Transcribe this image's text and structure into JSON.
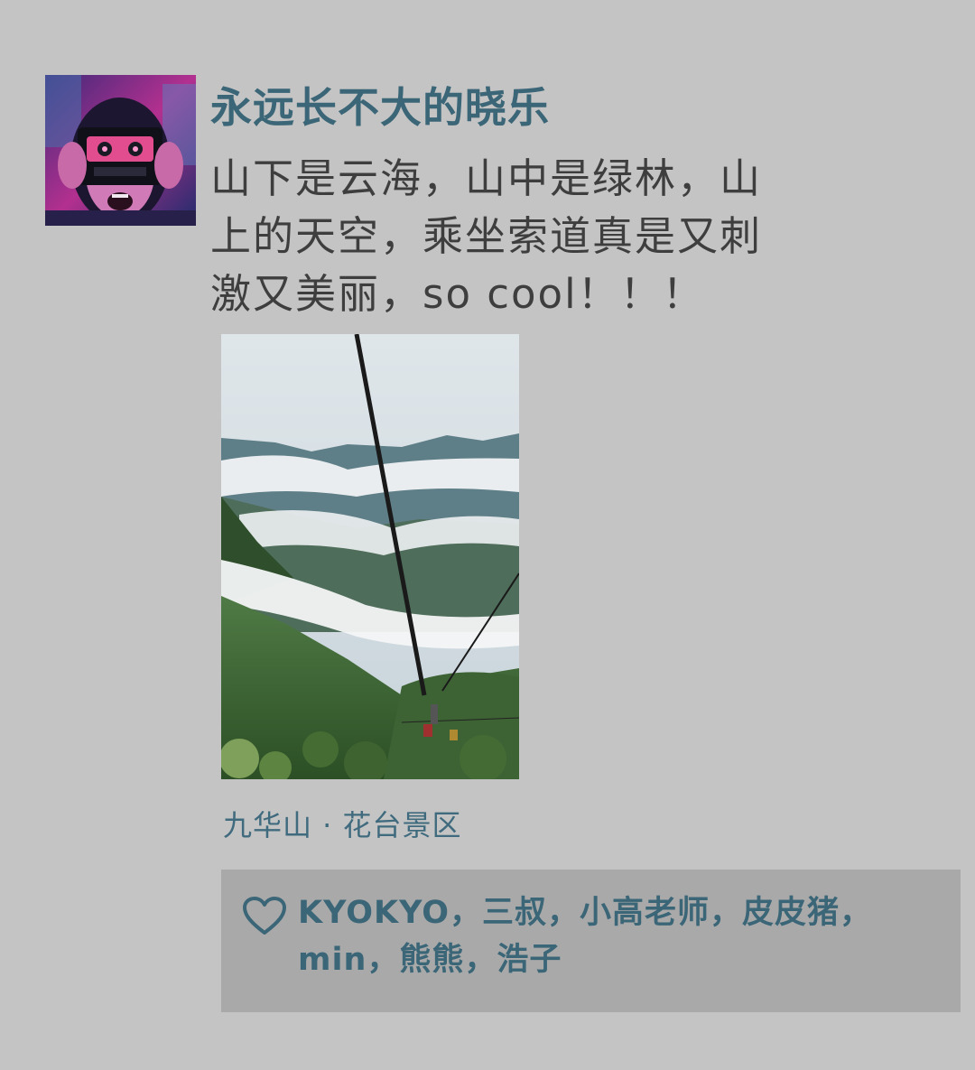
{
  "post": {
    "author": "永远长不大的晓乐",
    "text_lines": [
      "山下是云海，山中是绿林，山",
      "上的天空，乘坐索道真是又刺",
      "激又美丽，so cool！！！"
    ],
    "location": "九华山 · 花台景区"
  },
  "likes": {
    "icon": "heart-icon",
    "lines": [
      "KYOKYO，三叔，小高老师，皮皮猪，",
      "min，熊熊，浩子"
    ]
  },
  "colors": {
    "background": "#c4c4c4",
    "name": "#3b6677",
    "text": "#3e3e3e",
    "likes_box": "#a9a9a9"
  }
}
